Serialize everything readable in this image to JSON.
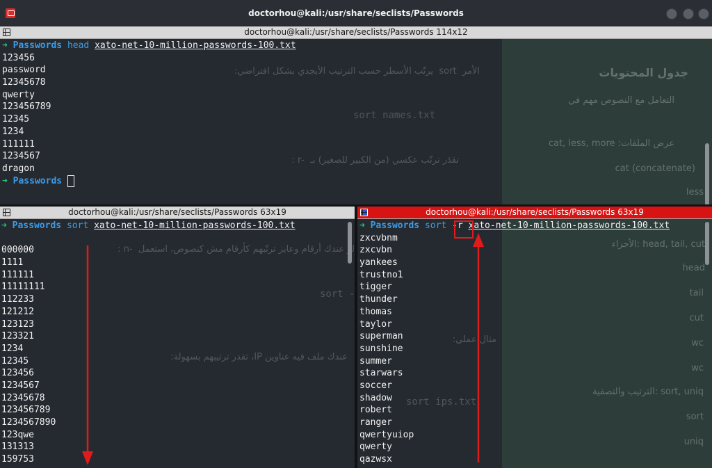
{
  "window": {
    "title": "doctorhou@kali:/usr/share/seclists/Passwords"
  },
  "top_pane": {
    "header": "doctorhou@kali:/usr/share/seclists/Passwords 114x12",
    "prompt_arrow": "➜",
    "prompt_dir": "Passwords",
    "command": "head",
    "file": "xato-net-10-million-passwords-100.txt",
    "output": [
      "123456",
      "password",
      "12345678",
      "qwerty",
      "123456789",
      "12345",
      "1234",
      "111111",
      "1234567",
      "dragon"
    ]
  },
  "left_pane": {
    "header": "doctorhou@kali:/usr/share/seclists/Passwords 63x19",
    "prompt_arrow": "➜",
    "prompt_dir": "Passwords",
    "command": "sort",
    "file": "xato-net-10-million-passwords-100.txt",
    "output": [
      "",
      "000000",
      "1111",
      "111111",
      "11111111",
      "112233",
      "121212",
      "123123",
      "123321",
      "1234",
      "12345",
      "123456",
      "1234567",
      "12345678",
      "123456789",
      "1234567890",
      "123qwe",
      "131313",
      "159753"
    ]
  },
  "right_pane": {
    "header": "doctorhou@kali:/usr/share/seclists/Passwords 63x19",
    "prompt_arrow": "➜",
    "prompt_dir": "Passwords",
    "command": "sort",
    "flag": "-r",
    "file": "xato-net-10-million-passwords-100.txt",
    "output": [
      "zxcvbnm",
      "zxcvbn",
      "yankees",
      "trustno1",
      "tigger",
      "thunder",
      "thomas",
      "taylor",
      "superman",
      "sunshine",
      "summer",
      "starwars",
      "soccer",
      "shadow",
      "robert",
      "ranger",
      "qwertyuiop",
      "qwerty",
      "qazwsx"
    ]
  },
  "background_page": {
    "heading": "جدول المحتويات",
    "toc": [
      "التعامل مع النصوص مهم في",
      "عرض الملفات: cat, less, more",
      "cat (concatenate)",
      "less",
      "head, tail, cut :الأجزاء",
      "head",
      "tail",
      "cut",
      "wc",
      "wc",
      "sort, uniq :الترتيب والتصفية",
      "sort",
      "uniq"
    ],
    "text1": "الأمر  sort  يرتّب الأسطر حسب الترتيب الأبجدي بشكل افتراضي:",
    "code1": "sort names.txt",
    "text2": "تقدَر ترتّب عكسي (من الكبير للصغير) بـ  -r :",
    "text3": "لو عندك أرقام وعايز ترتّبهم كأرقام مش كنصوص، استعمل  -n :",
    "code2": "sort -n numbers.txt",
    "text4": "مثال عملي:",
    "text5": "عندك ملف فيه عناوين IP، تقدر ترتيبهم بسهولة:",
    "code3": "sort ips.txt"
  },
  "colors": {
    "accent_red": "#e01b1b",
    "prompt_green": "#2ec27e",
    "prompt_blue": "#3c9be8"
  }
}
